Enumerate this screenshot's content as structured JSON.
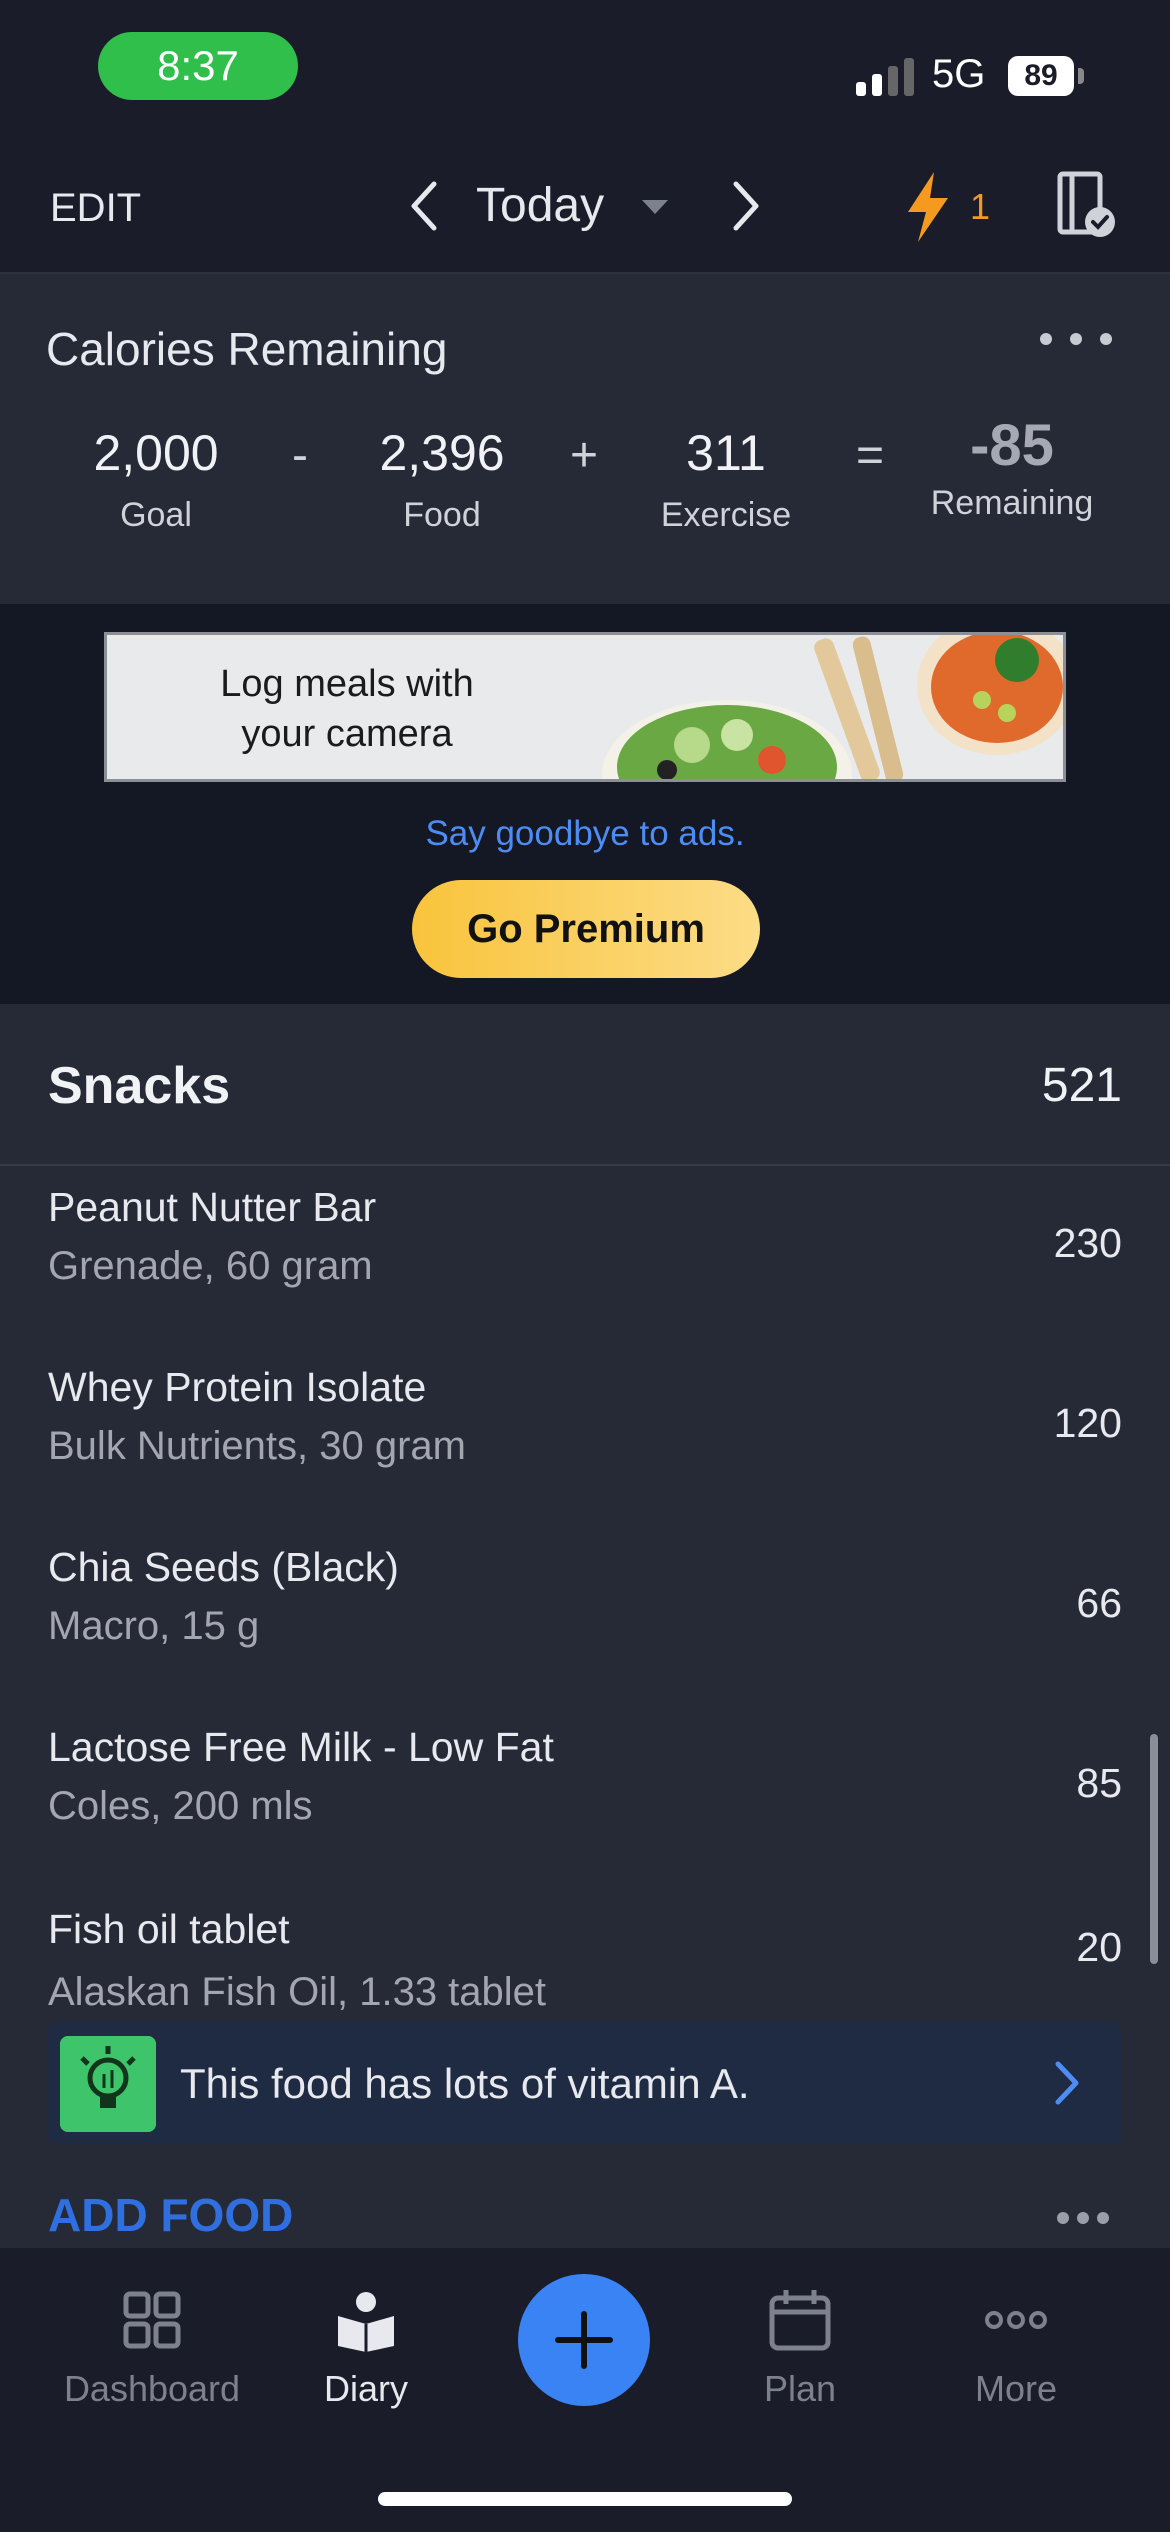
{
  "status_bar": {
    "time": "8:37",
    "network": "5G",
    "battery": "89"
  },
  "top_nav": {
    "edit_label": "EDIT",
    "date_label": "Today",
    "streak_count": "1"
  },
  "calories": {
    "title": "Calories Remaining",
    "goal": {
      "value": "2,000",
      "label": "Goal"
    },
    "food": {
      "value": "2,396",
      "label": "Food"
    },
    "exercise": {
      "value": "311",
      "label": "Exercise"
    },
    "remaining": {
      "value": "-85",
      "label": "Remaining"
    },
    "ops": [
      "-",
      "+",
      "="
    ]
  },
  "ad": {
    "banner_text_line1": "Log meals with",
    "banner_text_line2": "your camera",
    "goodbye_text": "Say goodbye to ads.",
    "premium_label": "Go Premium"
  },
  "snacks": {
    "title": "Snacks",
    "total": "521",
    "items": [
      {
        "name": "Peanut Nutter Bar",
        "detail": "Grenade, 60 gram",
        "calories": "230"
      },
      {
        "name": "Whey Protein Isolate",
        "detail": "Bulk Nutrients, 30 gram",
        "calories": "120"
      },
      {
        "name": "Chia Seeds (Black)",
        "detail": "Macro, 15 g",
        "calories": "66"
      },
      {
        "name": "Lactose Free Milk - Low Fat",
        "detail": "Coles, 200 mls",
        "calories": "85"
      },
      {
        "name": "Fish oil tablet",
        "detail": "Alaskan Fish Oil, 1.33 tablet",
        "calories": "20"
      }
    ],
    "tip_text": "This food has lots of vitamin A.",
    "add_food_label": "ADD FOOD"
  },
  "bottom_nav": {
    "tabs": [
      {
        "label": "Dashboard"
      },
      {
        "label": "Diary"
      },
      {
        "label": "Plan"
      },
      {
        "label": "More"
      }
    ],
    "active_tab": "Diary"
  },
  "colors": {
    "background": "#1a1d29",
    "card": "#262a37",
    "accent_blue": "#3a83f5",
    "streak_orange": "#f59a1f",
    "premium_yellow": "#f9c43c",
    "tip_green": "#3ec46a"
  }
}
